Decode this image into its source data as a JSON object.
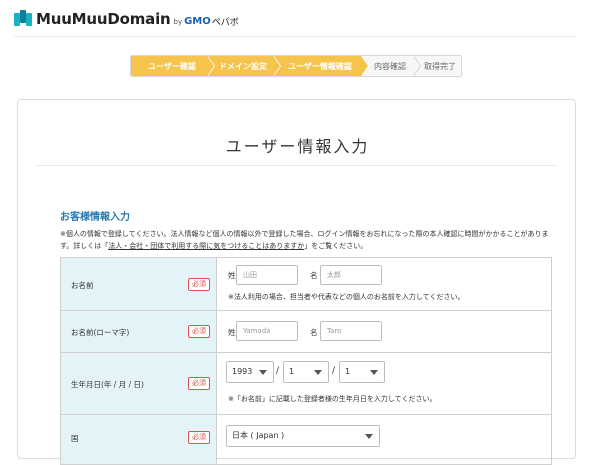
{
  "header": {
    "brand": "MuuMuuDomain",
    "by": "by",
    "gmo": "GMO",
    "pepabo": "ペパボ"
  },
  "steps": [
    {
      "label": "ユーザー確認",
      "state": "active"
    },
    {
      "label": "ドメイン設定",
      "state": "active"
    },
    {
      "label": "ユーザー情報確認",
      "state": "active"
    },
    {
      "label": "内容確認",
      "state": "inactive"
    },
    {
      "label": "取得完了",
      "state": "inactive"
    }
  ],
  "page": {
    "title": "ユーザー情報入力",
    "section_title": "お客様情報入力",
    "notice_1": "※個人の情報で登録してください。法人情報など個人の情報以外で登録した場合、ログイン情報をお忘れになった際の本人確認に時間がかかることがあります。詳しくは「",
    "notice_link": "法人・会社・団体で利用する際に気をつけることはありますか",
    "notice_2": "」をご覧ください。"
  },
  "form": {
    "required_label": "必須",
    "name": {
      "label": "お名前",
      "last_label": "姓",
      "last_placeholder": "山田",
      "first_label": "名",
      "first_placeholder": "太郎",
      "hint": "※法人利用の場合、担当者や代表などの個人のお名前を入力してください。"
    },
    "name_roman": {
      "label": "お名前(ローマ字)",
      "last_label": "姓",
      "last_placeholder": "Yamada",
      "first_label": "名",
      "first_placeholder": "Taro"
    },
    "birthday": {
      "label": "生年月日(年 / 月 / 日)",
      "year": "1993",
      "month": "1",
      "day": "1",
      "separator": "/",
      "hint": "※「お名前」に記載した登録者様の生年月日を入力してください。"
    },
    "country": {
      "label": "国",
      "value": "日本 ( Japan )"
    }
  },
  "colors": {
    "step_active": "#f6c44c",
    "label_bg": "#e3f3f8",
    "section_title": "#2a7ab0",
    "required": "#d9534f"
  }
}
